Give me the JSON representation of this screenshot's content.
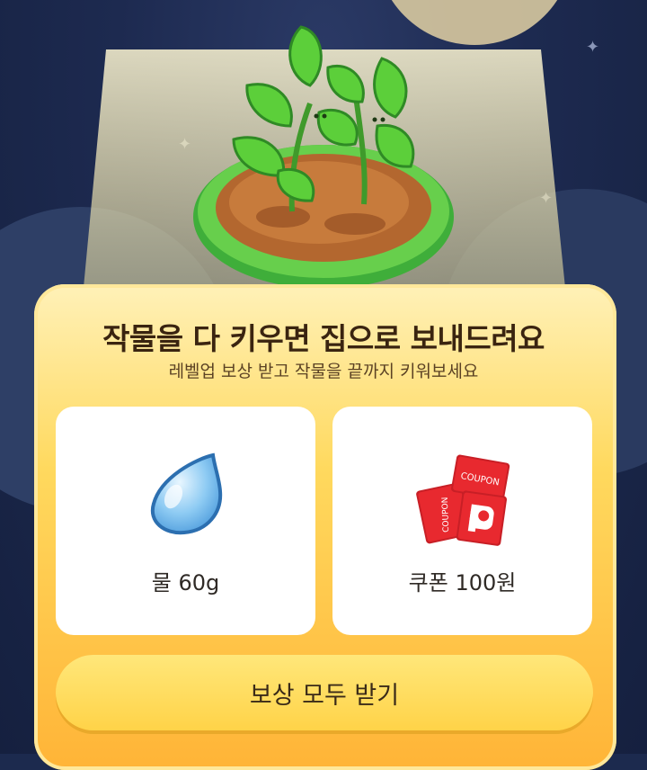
{
  "modal": {
    "title": "작물을 다 키우면 집으로 보내드려요",
    "subtitle": "레벨업 보상 받고 작물을 끝까지 키워보세요"
  },
  "rewards": [
    {
      "icon": "water-drop-icon",
      "label": "물 60g"
    },
    {
      "icon": "coupon-icon",
      "label": "쿠폰 100원"
    }
  ],
  "coupon_text": "COUPON",
  "claim_button": {
    "label": "보상 모두 받기"
  },
  "colors": {
    "background": "#1c2a4e",
    "card_top": "#fff1b8",
    "card_bottom": "#ffb437",
    "button": "#ffd348",
    "coupon_red": "#e8292f",
    "leaf": "#5ccf3a"
  }
}
